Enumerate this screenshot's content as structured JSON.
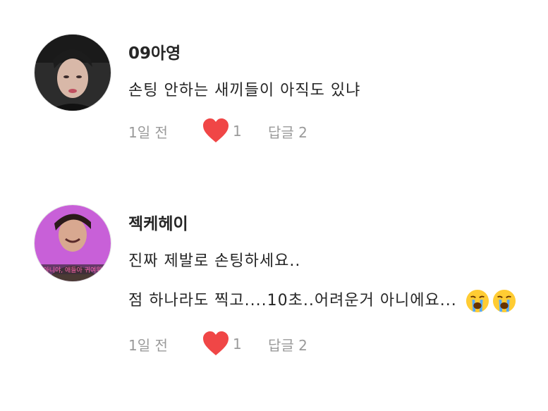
{
  "comments": [
    {
      "username": "09아영",
      "lines": [
        "손팅 안하는 새끼들이 아직도 있냐"
      ],
      "time": "1일 전",
      "likes": "1",
      "reply": "답글 2"
    },
    {
      "username": "젝케헤이",
      "lines": [
        "진짜 제발로 손팅하세요..",
        "점 하나라도 찍고....10초..어려운거 아니에요..."
      ],
      "avatar_caption": "아니야, 애들아 귀여워",
      "time": "1일 전",
      "likes": "1",
      "reply": "답글 2"
    }
  ],
  "icons": {
    "like": "heart-icon",
    "emoji": "loudly-crying-face-emoji"
  },
  "colors": {
    "heart": "#f04646",
    "meta_text": "#9a9a9a",
    "avatar2_bg": "#c860d8"
  }
}
